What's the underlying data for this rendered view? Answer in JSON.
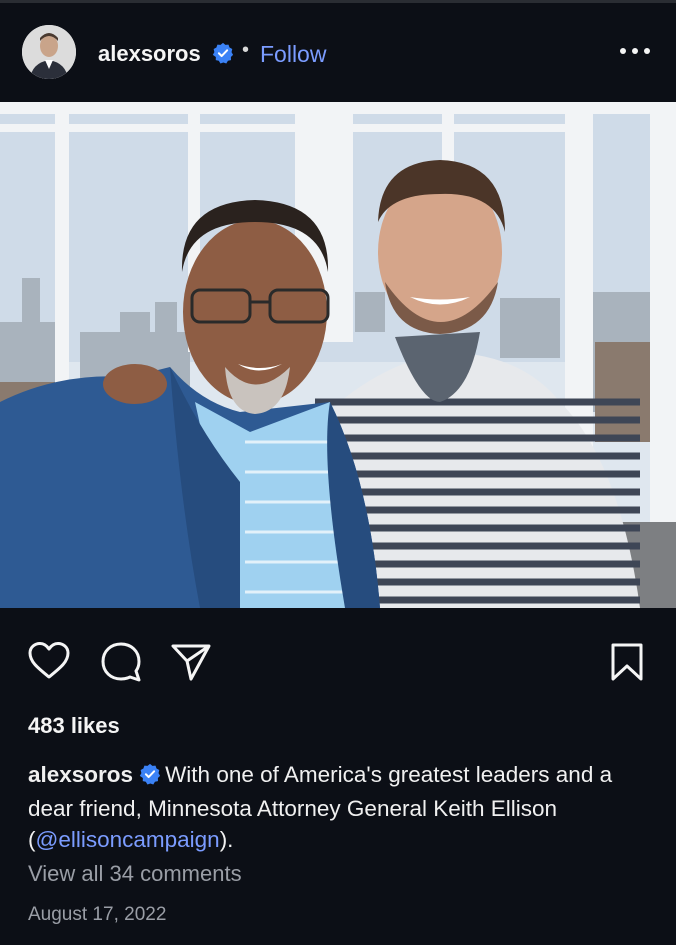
{
  "post": {
    "username": "alexsoros",
    "separator": "•",
    "follow_label": "Follow",
    "likes": "483 likes",
    "caption_user": "alexsoros",
    "caption_text_1": "With one of America's greatest leaders and a dear friend, Minnesota Attorney General Keith Ellison (",
    "caption_mention": "@ellisoncampaign",
    "caption_text_2": ").",
    "view_comments": "View all 34 comments",
    "date": "August 17, 2022"
  },
  "icons": {
    "verified": "verified-badge-icon",
    "more": "more-options-icon",
    "like": "heart-icon",
    "comment": "comment-icon",
    "share": "share-icon",
    "save": "bookmark-icon"
  },
  "colors": {
    "background": "#0c0f16",
    "accent": "#7b9cff",
    "verified": "#3b82f6",
    "muted": "#9a9ea6"
  }
}
